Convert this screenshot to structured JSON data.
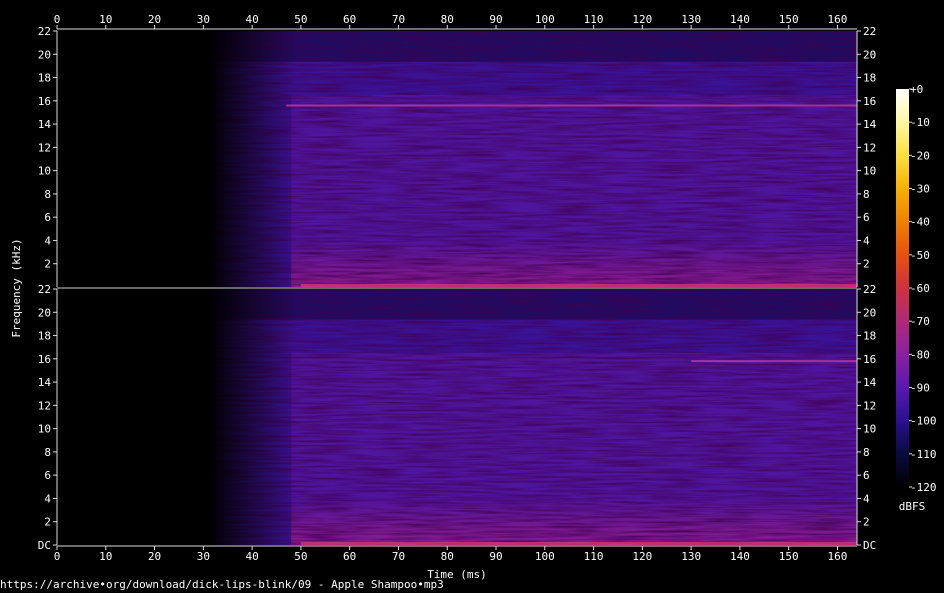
{
  "source_url": "https://archive•org/download/dick-lips-blink/09 - Apple Shampoo•mp3",
  "chart_data": {
    "type": "heatmap",
    "kind": "spectrogram",
    "channels": 2,
    "xlabel": "Time (ms)",
    "ylabel": "Frequency (kHz)",
    "x_range": [
      0,
      164
    ],
    "x_ticks": [
      0,
      10,
      20,
      30,
      40,
      50,
      60,
      70,
      80,
      90,
      100,
      110,
      120,
      130,
      140,
      150,
      160
    ],
    "y_range_khz": [
      0,
      22
    ],
    "y_ticks": [
      "DC",
      "2",
      "4",
      "6",
      "8",
      "10",
      "12",
      "14",
      "16",
      "18",
      "20",
      "22"
    ],
    "y_tick_values": [
      0,
      2,
      4,
      6,
      8,
      10,
      12,
      14,
      16,
      18,
      20,
      22
    ],
    "colorbar": {
      "label": "dBFS",
      "range": [
        -120,
        0
      ],
      "ticks": [
        "+0",
        "-10",
        "-20",
        "-30",
        "-40",
        "-50",
        "-60",
        "-70",
        "-80",
        "-90",
        "-100",
        "-110",
        "-120"
      ],
      "tick_values": [
        0,
        -10,
        -20,
        -30,
        -40,
        -50,
        -60,
        -70,
        -80,
        -90,
        -100,
        -110,
        -120
      ],
      "colors": [
        "#000000",
        "#0a0a40",
        "#2a1090",
        "#5a18b0",
        "#8a20a0",
        "#b02878",
        "#d03040",
        "#e85010",
        "#f08000",
        "#f8b000",
        "#fce040",
        "#fff8a0",
        "#ffffff"
      ]
    },
    "signal_onset_ms": 31,
    "notable_features": [
      {
        "channel": 1,
        "type": "tone",
        "frequency_khz": 15.6,
        "start_ms": 47,
        "end_ms": 164
      },
      {
        "channel": 2,
        "type": "tone",
        "frequency_khz": 15.8,
        "start_ms": 130,
        "end_ms": 164
      }
    ],
    "grid": false
  }
}
